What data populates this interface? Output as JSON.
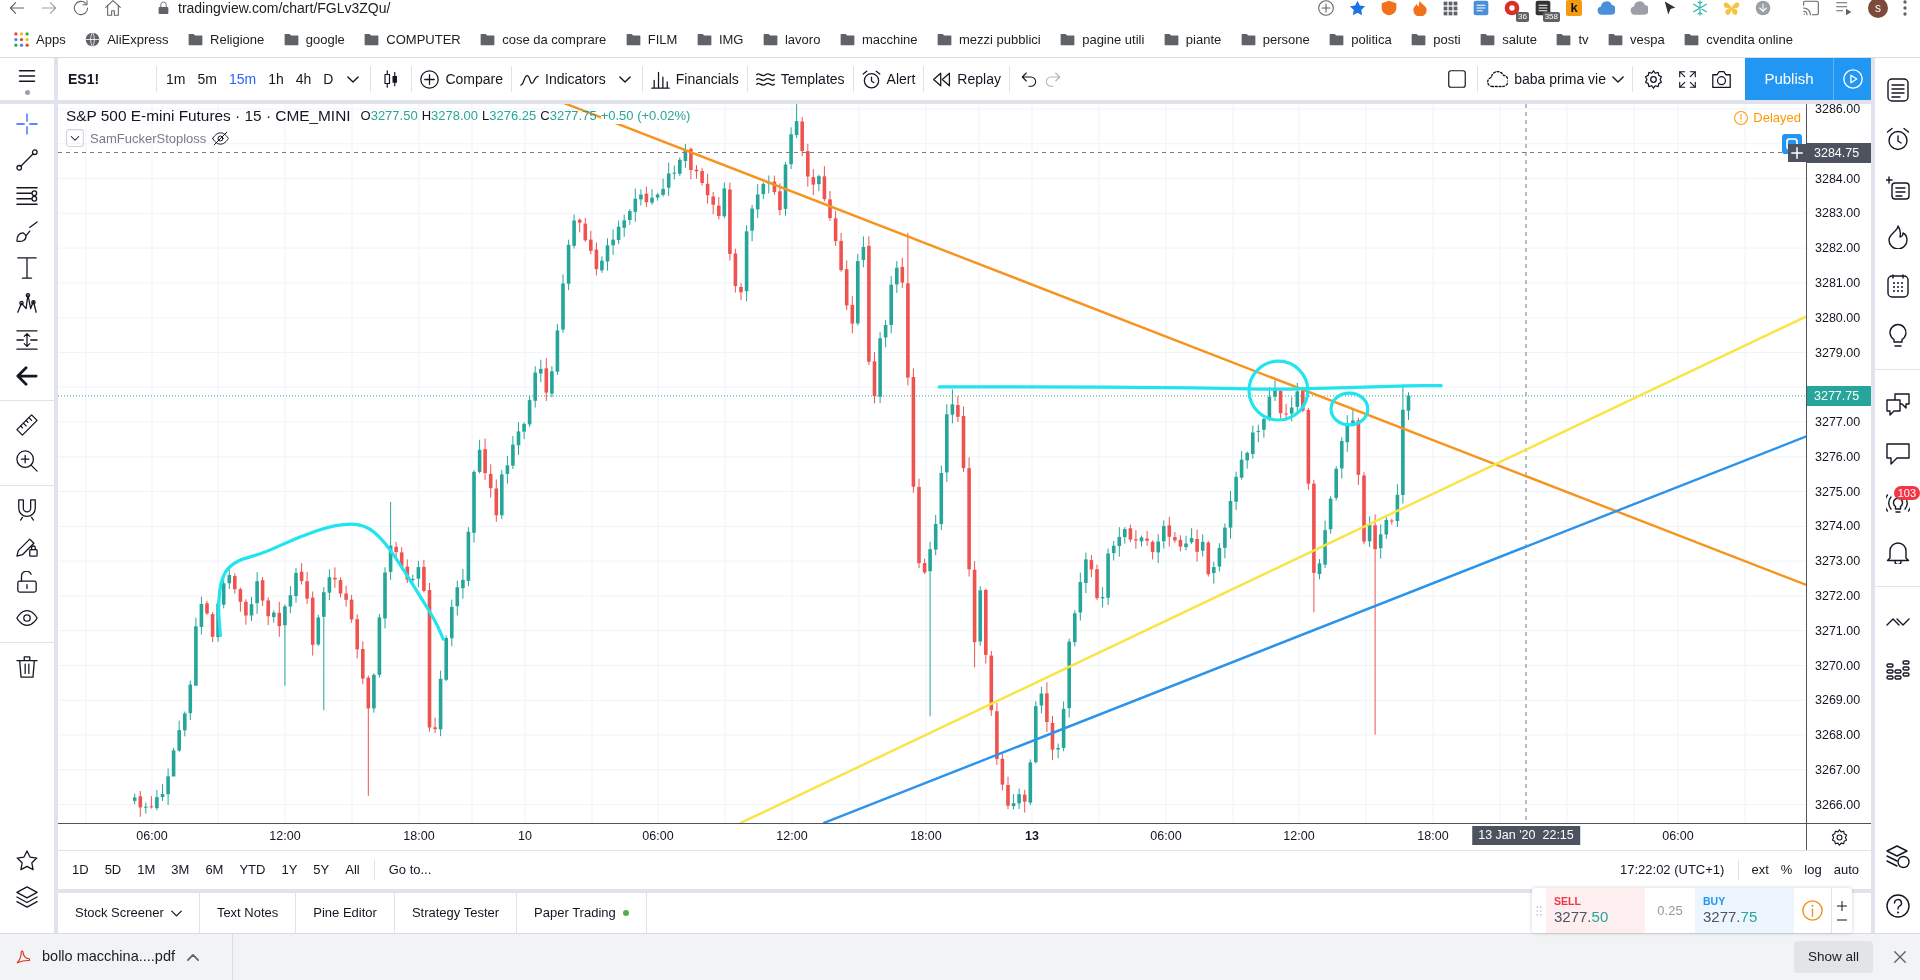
{
  "browser": {
    "address": "tradingview.com/chart/FGLv3ZQu/",
    "extension_badges": [
      "36",
      "358"
    ],
    "extension_label": "k",
    "profile_initial": "s",
    "bookmarks": [
      {
        "label": "Apps",
        "kind": "apps"
      },
      {
        "label": "AliExpress",
        "kind": "site"
      },
      {
        "label": "Religione",
        "kind": "folder"
      },
      {
        "label": "google",
        "kind": "folder"
      },
      {
        "label": "COMPUTER",
        "kind": "folder"
      },
      {
        "label": "cose da comprare",
        "kind": "folder"
      },
      {
        "label": "FILM",
        "kind": "folder"
      },
      {
        "label": "IMG",
        "kind": "folder"
      },
      {
        "label": "lavoro",
        "kind": "folder"
      },
      {
        "label": "macchine",
        "kind": "folder"
      },
      {
        "label": "mezzi pubblici",
        "kind": "folder"
      },
      {
        "label": "pagine utili",
        "kind": "folder"
      },
      {
        "label": "piante",
        "kind": "folder"
      },
      {
        "label": "persone",
        "kind": "folder"
      },
      {
        "label": "politica",
        "kind": "folder"
      },
      {
        "label": "posti",
        "kind": "folder"
      },
      {
        "label": "salute",
        "kind": "folder"
      },
      {
        "label": "tv",
        "kind": "folder"
      },
      {
        "label": "vespa",
        "kind": "folder"
      },
      {
        "label": "cvendita online",
        "kind": "folder"
      }
    ]
  },
  "toolbar": {
    "symbol": "ES1!",
    "intervals": [
      {
        "label": "1m",
        "selected": false
      },
      {
        "label": "5m",
        "selected": false
      },
      {
        "label": "15m",
        "selected": true
      },
      {
        "label": "1h",
        "selected": false
      },
      {
        "label": "4h",
        "selected": false
      },
      {
        "label": "D",
        "selected": false
      }
    ],
    "buttons": [
      {
        "label": "Compare",
        "kind": "compare"
      },
      {
        "label": "Indicators",
        "kind": "indicators"
      },
      {
        "label": "Financials",
        "kind": "financials"
      },
      {
        "label": "Templates",
        "kind": "templates"
      },
      {
        "label": "Alert",
        "kind": "alert"
      },
      {
        "label": "Replay",
        "kind": "replay"
      }
    ],
    "layout_name": "baba prima vie",
    "publish": "Publish"
  },
  "left_toolbar": {
    "tools": [
      {
        "kind": "crosshair",
        "selected": true
      },
      {
        "kind": "trend_line",
        "selected": false
      },
      {
        "kind": "parallel_lines",
        "selected": false
      },
      {
        "kind": "brush",
        "selected": false
      },
      {
        "kind": "text",
        "selected": false
      },
      {
        "kind": "pattern",
        "selected": false
      },
      {
        "kind": "projection",
        "selected": false
      },
      {
        "kind": "arrow",
        "selected": false
      }
    ]
  },
  "chart": {
    "legend": {
      "title": "S&P 500 E-mini Futures · 15 · CME_MINI",
      "ohlc": [
        {
          "label": "O",
          "value": "3277.50"
        },
        {
          "label": "H",
          "value": "3278.00"
        },
        {
          "label": "L",
          "value": "3276.25"
        },
        {
          "label": "C",
          "value": "3277.75"
        }
      ],
      "change": "+0.50 (+0.02%)"
    },
    "study": {
      "name": "SamFuckerStoploss",
      "hidden": true
    },
    "status": "Delayed",
    "price_labels": [
      "3286.00",
      "3284.00",
      "3283.00",
      "3282.00",
      "3281.00",
      "3280.00",
      "3279.00",
      "3277.00",
      "3276.00",
      "3275.00",
      "3274.00",
      "3273.00",
      "3272.00",
      "3271.00",
      "3270.00",
      "3269.00",
      "3268.00",
      "3267.00",
      "3266.00"
    ],
    "crosshair_price": "3284.75",
    "last_price": "3277.75",
    "time_labels": [
      {
        "label": "06:00",
        "emphasized": false
      },
      {
        "label": "12:00",
        "emphasized": false
      },
      {
        "label": "18:00",
        "emphasized": false
      },
      {
        "label": "10",
        "emphasized": false
      },
      {
        "label": "06:00",
        "emphasized": false
      },
      {
        "label": "12:00",
        "emphasized": false
      },
      {
        "label": "18:00",
        "emphasized": false
      },
      {
        "label": "13",
        "emphasized": true
      },
      {
        "label": "06:00",
        "emphasized": false
      },
      {
        "label": "12:00",
        "emphasized": false
      },
      {
        "label": "18:00",
        "emphasized": false
      },
      {
        "label": "06:00",
        "emphasized": false
      }
    ],
    "crosshair_time": "13 Jan '20  22:15",
    "drawings": [
      {
        "kind": "trend_line",
        "color": "#f7931e"
      },
      {
        "kind": "trend_line",
        "color": "#f8e545"
      },
      {
        "kind": "trend_line",
        "color": "#2a93ea"
      },
      {
        "kind": "freehand",
        "color": "#22e4ee"
      },
      {
        "kind": "freehand",
        "color": "#22e4ee"
      },
      {
        "kind": "freehand",
        "color": "#22e4ee"
      },
      {
        "kind": "freehand",
        "color": "#22e4ee"
      }
    ]
  },
  "range_bar": {
    "ranges": [
      "1D",
      "5D",
      "1M",
      "3M",
      "6M",
      "YTD",
      "1Y",
      "5Y",
      "All"
    ],
    "goto": "Go to...",
    "clock": "17:22:02 (UTC+1)",
    "scale_options": [
      "ext",
      "%",
      "log",
      "auto"
    ]
  },
  "panel_tabs": [
    {
      "label": "Stock Screener",
      "dropdown": true,
      "connected": false
    },
    {
      "label": "Text Notes",
      "dropdown": false,
      "connected": false
    },
    {
      "label": "Pine Editor",
      "dropdown": false,
      "connected": false
    },
    {
      "label": "Strategy Tester",
      "dropdown": false,
      "connected": false
    },
    {
      "label": "Paper Trading",
      "dropdown": false,
      "connected": true
    }
  ],
  "trading": {
    "sell": {
      "label": "SELL",
      "price": "3277.",
      "price_tail": "50"
    },
    "spread": "0.25",
    "buy": {
      "label": "BUY",
      "price": "3277.",
      "price_tail": "75"
    }
  },
  "right_sidebar": {
    "badge": "103"
  },
  "download": {
    "file": "bollo macchina....pdf",
    "show_all": "Show all"
  }
}
